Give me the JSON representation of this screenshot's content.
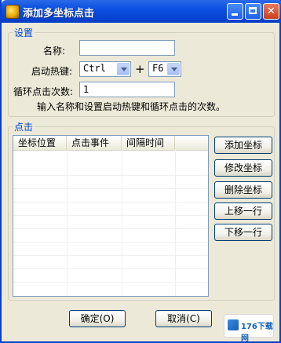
{
  "window": {
    "title": "添加多坐标点击",
    "controls": {
      "minimize": "",
      "maximize": "",
      "close": "✕"
    }
  },
  "settings": {
    "group_title": "设置",
    "name_label": "名称:",
    "name_value": "",
    "hotkey_label": "启动热键:",
    "modifier_value": "Ctrl",
    "plus_sign": "+",
    "key_value": "F6",
    "count_label": "循环点击次数:",
    "count_value": "1",
    "hint": "输入名称和设置启动热键和循环点击的次数。"
  },
  "click": {
    "group_title": "点击",
    "columns": [
      "坐标位置",
      "点击事件",
      "间隔时间"
    ],
    "rows": []
  },
  "side_buttons": {
    "add": "添加坐标",
    "edit": "修改坐标",
    "delete": "删除坐标",
    "move_up": "上移一行",
    "move_down": "下移一行"
  },
  "footer": {
    "ok": "确定(O)",
    "cancel": "取消(C)"
  },
  "watermark": {
    "text": "176下载网"
  },
  "colors": {
    "titlebar": "#0b4fe2",
    "dialog_bg": "#ece9d8",
    "group_title": "#0046d5",
    "button_border": "#003c74"
  }
}
